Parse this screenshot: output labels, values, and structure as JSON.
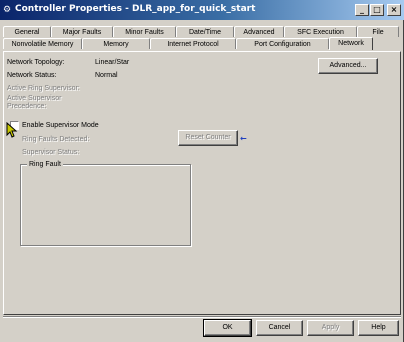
{
  "window": {
    "title": "Controller Properties - DLR_app_for_quick_start",
    "icon": "controller-icon",
    "minimize_label": "_",
    "maximize_label": "□",
    "close_label": "×"
  },
  "tabs_top": [
    {
      "label": "General"
    },
    {
      "label": "Major Faults"
    },
    {
      "label": "Minor Faults"
    },
    {
      "label": "Date/Time"
    },
    {
      "label": "Advanced"
    },
    {
      "label": "SFC Execution"
    },
    {
      "label": "File"
    }
  ],
  "tabs_bottom": [
    {
      "label": "Nonvolatile Memory"
    },
    {
      "label": "Memory"
    },
    {
      "label": "Internet Protocol"
    },
    {
      "label": "Port Configuration"
    },
    {
      "label": "Network"
    }
  ],
  "selected_tab": "Network",
  "network": {
    "topology_label": "Network Topology:",
    "topology_value": "Linear/Star",
    "status_label": "Network Status:",
    "status_value": "Normal",
    "active_ring_supervisor_label": "Active Ring Supervisor:",
    "active_supervisor_precedence_label_1": "Active Supervisor",
    "active_supervisor_precedence_label_2": "Precedence:",
    "advanced_button": "Advanced...",
    "enable_supervisor_label": "Enable Supervisor Mode",
    "enable_supervisor_checked": false,
    "ring_faults_detected_label": "Ring Faults Detected:",
    "supervisor_status_label": "Supervisor Status:",
    "reset_counter_button": "Reset Counter",
    "ring_fault_group": "Ring Fault"
  },
  "footer": {
    "ok": "OK",
    "cancel": "Cancel",
    "apply": "Apply",
    "help": "Help"
  },
  "colors": {
    "titlebar_start": "#0a246a",
    "titlebar_end": "#a6caf0",
    "dialog_bg": "#d4d0c8",
    "disabled_text": "#808080",
    "arrow_indicator": "#1f3fbf"
  }
}
